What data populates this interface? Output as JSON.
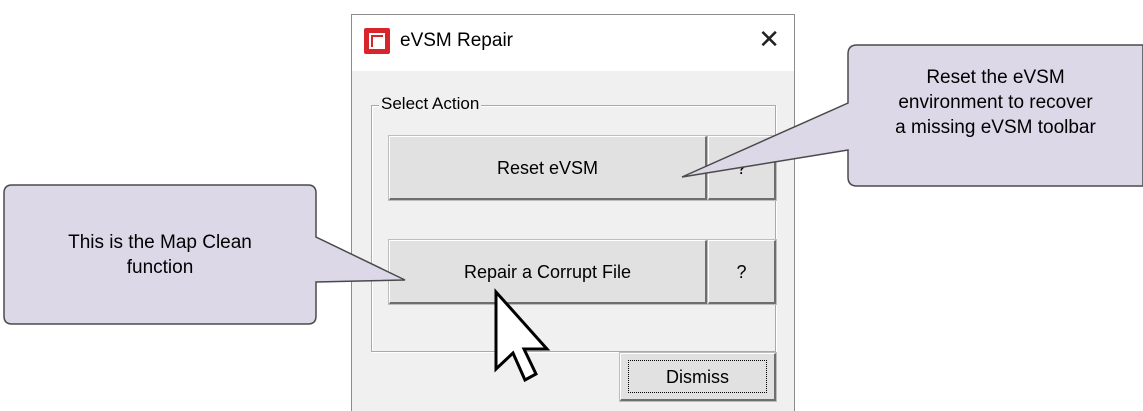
{
  "dialog": {
    "title": "eVSM Repair",
    "close_glyph": "✕",
    "group_label": "Select Action",
    "reset_label": "Reset eVSM",
    "reset_help": "?",
    "repair_label": "Repair a Corrupt File",
    "repair_help": "?",
    "dismiss_label": "Dismiss"
  },
  "callouts": {
    "left": [
      "This is the Map Clean",
      "function"
    ],
    "right": [
      "Reset the eVSM",
      "environment to recover",
      "a missing eVSM toolbar"
    ]
  },
  "icons": {
    "app": "evsm-app-icon",
    "close": "close-icon",
    "cursor": "mouse-pointer-icon"
  },
  "colors": {
    "callout_fill": "#dcd8e8",
    "callout_stroke": "#4a4a4a",
    "app_icon": "#d8242b",
    "dialog_bg": "#f0f0f0"
  }
}
